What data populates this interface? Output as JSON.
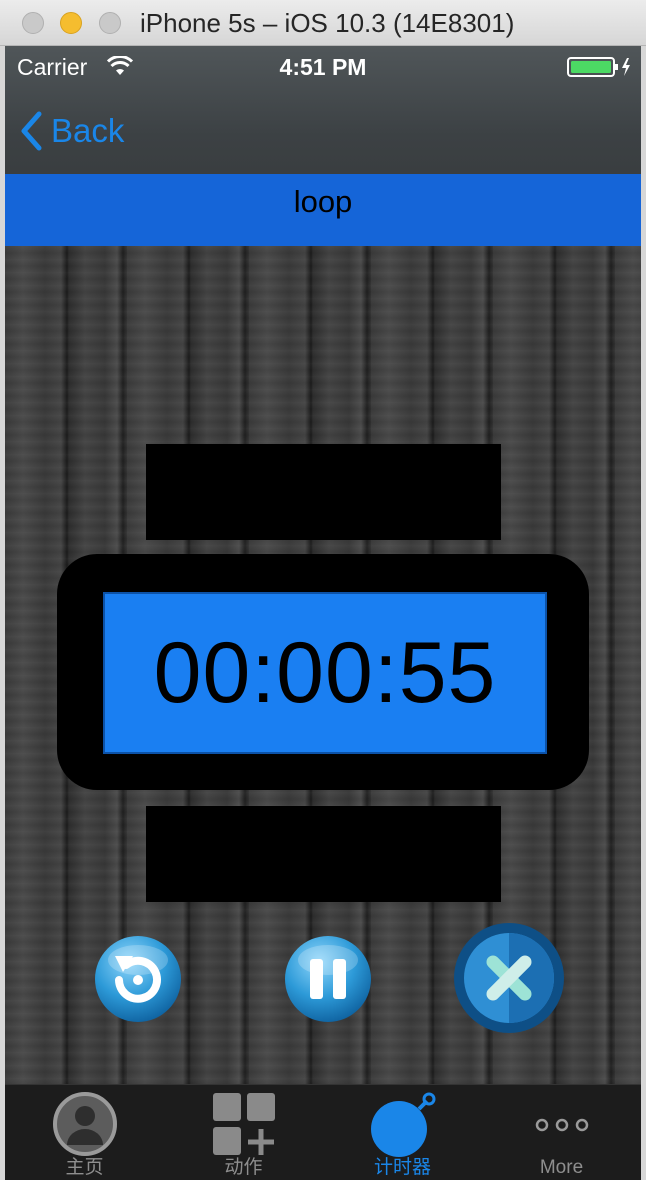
{
  "window": {
    "title": "iPhone 5s – iOS 10.3 (14E8301)"
  },
  "status_bar": {
    "carrier": "Carrier",
    "time": "4:51 PM"
  },
  "nav": {
    "back_label": "Back"
  },
  "page": {
    "title": "loop"
  },
  "timer": {
    "display": "00:00:55"
  },
  "controls": {
    "reset_icon": "reset-icon",
    "pause_icon": "pause-icon",
    "close_icon": "close-icon"
  },
  "tabs": [
    {
      "label": "主页",
      "icon": "person-icon",
      "active": false
    },
    {
      "label": "动作",
      "icon": "grid-plus-icon",
      "active": false
    },
    {
      "label": "计时器",
      "icon": "stopwatch-icon",
      "active": true
    },
    {
      "label": "More",
      "icon": "more-icon",
      "active": false
    }
  ],
  "colors": {
    "accent_blue": "#1a86e8",
    "title_bar_blue": "#1565d8",
    "timer_blue": "#1a7ff2",
    "battery_green": "#4cd964"
  }
}
